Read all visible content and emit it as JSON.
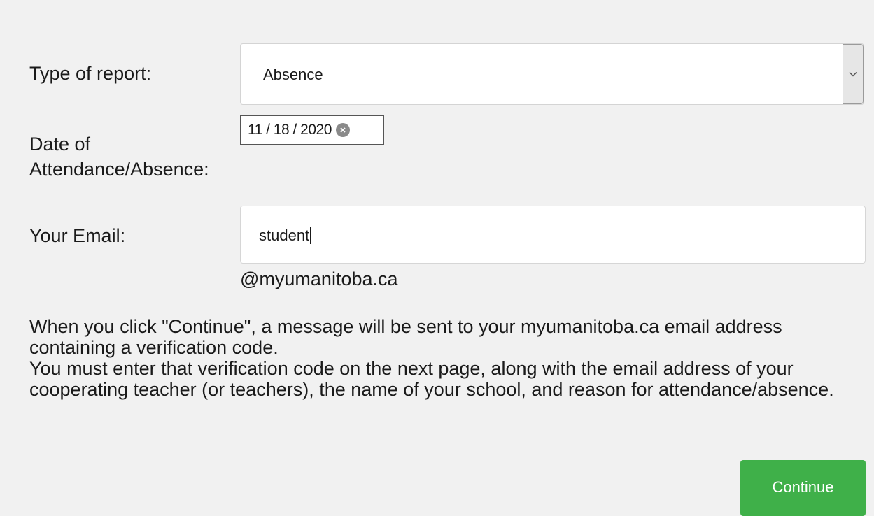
{
  "form": {
    "report_type": {
      "label": "Type of report:",
      "selected_value": "Absence"
    },
    "date": {
      "label_line1": "Date of",
      "label_line2": "Attendance/Absence:",
      "value": "11 / 18 / 2020"
    },
    "email": {
      "label": "Your Email:",
      "value": "student",
      "domain_suffix": "@myumanitoba.ca"
    },
    "info": {
      "paragraph1": "When you click \"Continue\", a message will be sent to your myumanitoba.ca email address containing a verification code.",
      "paragraph2": "You must enter that verification code on the next page, along with the email address of your cooperating teacher (or teachers), the name of your school, and reason for attendance/absence."
    },
    "continue_button_label": "Continue"
  },
  "icons": {
    "select_arrow": "chevron-down-icon",
    "date_clear": "clear-icon"
  },
  "colors": {
    "background": "#f1f1f1",
    "button_green": "#3fb049",
    "button_text": "#ffffff"
  }
}
